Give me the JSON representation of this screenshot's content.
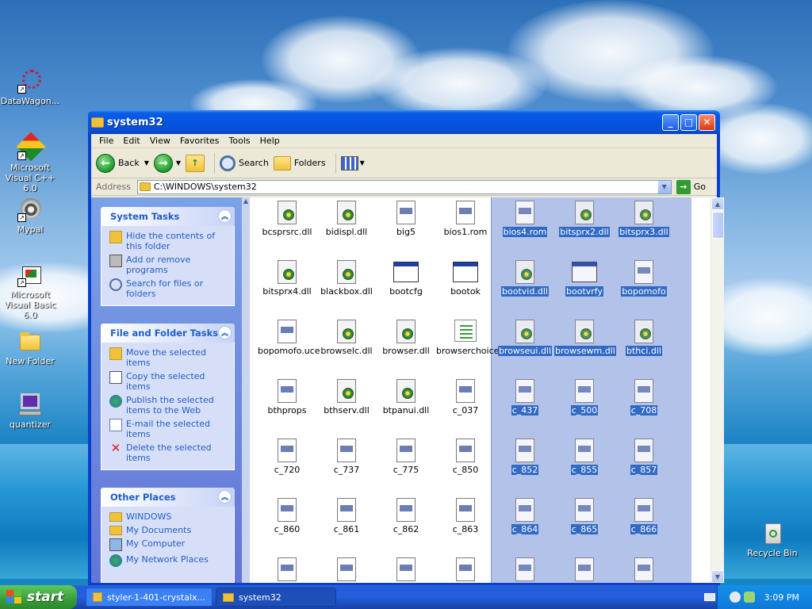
{
  "desktop": {
    "icons": [
      {
        "label": "DataWagon..."
      },
      {
        "label": "Microsoft Visual C++ 6.0"
      },
      {
        "label": "Mypal"
      },
      {
        "label": "Microsoft Visual Basic 6.0"
      },
      {
        "label": "New Folder"
      },
      {
        "label": "quantizer"
      },
      {
        "label": "Recycle Bin"
      }
    ]
  },
  "window": {
    "title": "system32",
    "menu": [
      "File",
      "Edit",
      "View",
      "Favorites",
      "Tools",
      "Help"
    ],
    "toolbar": {
      "back": "Back",
      "search": "Search",
      "folders": "Folders"
    },
    "address": {
      "label": "Address",
      "value": "C:\\WINDOWS\\system32",
      "go": "Go"
    }
  },
  "tasks": {
    "system": {
      "title": "System Tasks",
      "items": [
        "Hide the contents of this folder",
        "Add or remove programs",
        "Search for files or folders"
      ]
    },
    "file_folder": {
      "title": "File and Folder Tasks",
      "items": [
        "Move the selected items",
        "Copy the selected items",
        "Publish the selected items to the Web",
        "E-mail the selected items",
        "Delete the selected items"
      ]
    },
    "other": {
      "title": "Other Places",
      "items": [
        "WINDOWS",
        "My Documents",
        "My Computer",
        "My Network Places"
      ]
    }
  },
  "files": [
    {
      "name": "bcsprsrc.dll",
      "icon": "dll",
      "selected": false
    },
    {
      "name": "bidispl.dll",
      "icon": "dll",
      "selected": false
    },
    {
      "name": "big5",
      "icon": "doc",
      "selected": false
    },
    {
      "name": "bios1.rom",
      "icon": "doc",
      "selected": false
    },
    {
      "name": "bios4.rom",
      "icon": "doc",
      "selected": true
    },
    {
      "name": "bitsprx2.dll",
      "icon": "dll",
      "selected": true
    },
    {
      "name": "bitsprx3.dll",
      "icon": "dll",
      "selected": true
    },
    {
      "name": "bitsprx4.dll",
      "icon": "dll",
      "selected": false
    },
    {
      "name": "blackbox.dll",
      "icon": "dll",
      "selected": false
    },
    {
      "name": "bootcfg",
      "icon": "app",
      "selected": false
    },
    {
      "name": "bootok",
      "icon": "app",
      "selected": false
    },
    {
      "name": "bootvid.dll",
      "icon": "dll",
      "selected": true
    },
    {
      "name": "bootvrfy",
      "icon": "app",
      "selected": true
    },
    {
      "name": "bopomofo",
      "icon": "doc",
      "selected": true
    },
    {
      "name": "bopomofo.uce",
      "icon": "doc",
      "selected": false
    },
    {
      "name": "browselc.dll",
      "icon": "dll",
      "selected": false
    },
    {
      "name": "browser.dll",
      "icon": "dll",
      "selected": false
    },
    {
      "name": "browserchoice",
      "icon": "list",
      "selected": false
    },
    {
      "name": "browseui.dll",
      "icon": "dll",
      "selected": true
    },
    {
      "name": "browsewm.dll",
      "icon": "dll",
      "selected": true
    },
    {
      "name": "bthci.dll",
      "icon": "dll",
      "selected": true
    },
    {
      "name": "bthprops",
      "icon": "doc",
      "selected": false
    },
    {
      "name": "bthserv.dll",
      "icon": "dll",
      "selected": false
    },
    {
      "name": "btpanui.dll",
      "icon": "dll",
      "selected": false
    },
    {
      "name": "c_037",
      "icon": "doc",
      "selected": false
    },
    {
      "name": "c_437",
      "icon": "doc",
      "selected": true
    },
    {
      "name": "c_500",
      "icon": "doc",
      "selected": true
    },
    {
      "name": "c_708",
      "icon": "doc",
      "selected": true
    },
    {
      "name": "c_720",
      "icon": "doc",
      "selected": false
    },
    {
      "name": "c_737",
      "icon": "doc",
      "selected": false
    },
    {
      "name": "c_775",
      "icon": "doc",
      "selected": false
    },
    {
      "name": "c_850",
      "icon": "doc",
      "selected": false
    },
    {
      "name": "c_852",
      "icon": "doc",
      "selected": true
    },
    {
      "name": "c_855",
      "icon": "doc",
      "selected": true
    },
    {
      "name": "c_857",
      "icon": "doc",
      "selected": true
    },
    {
      "name": "c_860",
      "icon": "doc",
      "selected": false
    },
    {
      "name": "c_861",
      "icon": "doc",
      "selected": false
    },
    {
      "name": "c_862",
      "icon": "doc",
      "selected": false
    },
    {
      "name": "c_863",
      "icon": "doc",
      "selected": false
    },
    {
      "name": "c_864",
      "icon": "doc",
      "selected": true
    },
    {
      "name": "c_865",
      "icon": "doc",
      "selected": true
    },
    {
      "name": "c_866",
      "icon": "doc",
      "selected": true
    }
  ],
  "taskbar": {
    "start": "start",
    "items": [
      "styler-1-401-crystalx...",
      "system32"
    ],
    "clock": "3:09 PM"
  },
  "colors": {
    "selection": "#316ac5",
    "titlebar": "#0353e0",
    "taskpane": "#6375d6"
  }
}
